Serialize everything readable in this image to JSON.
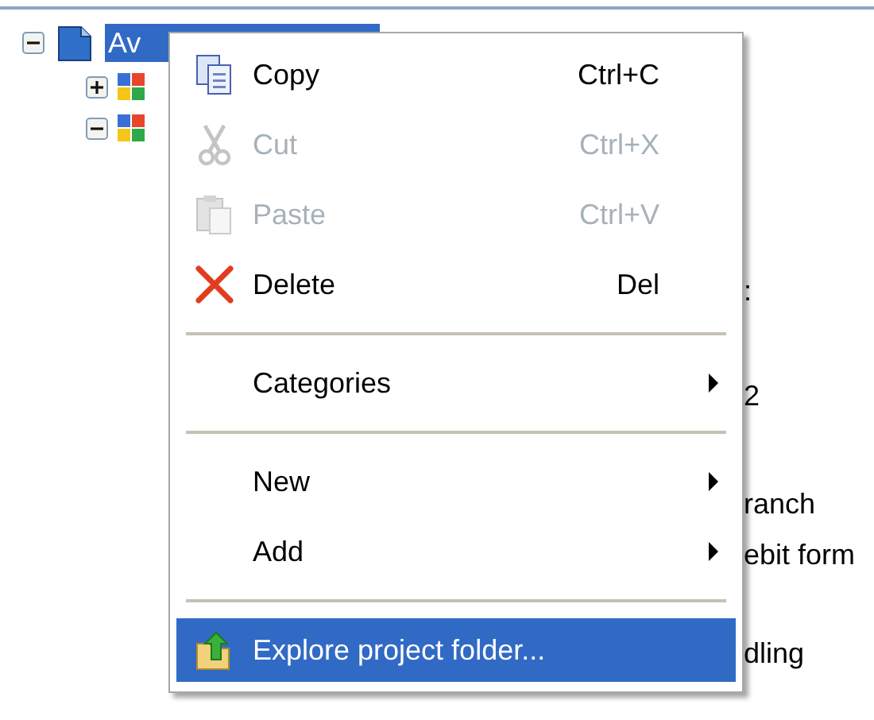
{
  "tree": {
    "root": {
      "label": "Av",
      "selected": true,
      "expanded": true
    },
    "children": [
      {
        "expanded": false
      },
      {
        "expanded": true
      }
    ]
  },
  "peek_texts": [
    ":",
    "2",
    "ranch",
    "ebit form",
    "dling"
  ],
  "context_menu": [
    {
      "kind": "item",
      "label": "Copy",
      "shortcut": "Ctrl+C",
      "disabled": false,
      "selected": false,
      "submenu": false
    },
    {
      "kind": "item",
      "label": "Cut",
      "shortcut": "Ctrl+X",
      "disabled": true,
      "selected": false,
      "submenu": false
    },
    {
      "kind": "item",
      "label": "Paste",
      "shortcut": "Ctrl+V",
      "disabled": true,
      "selected": false,
      "submenu": false
    },
    {
      "kind": "item",
      "label": "Delete",
      "shortcut": "Del",
      "disabled": false,
      "selected": false,
      "submenu": false
    },
    {
      "kind": "separator"
    },
    {
      "kind": "item",
      "label": "Categories",
      "disabled": false,
      "selected": false,
      "submenu": true
    },
    {
      "kind": "separator"
    },
    {
      "kind": "item",
      "label": "New",
      "disabled": false,
      "selected": false,
      "submenu": true
    },
    {
      "kind": "item",
      "label": "Add",
      "disabled": false,
      "selected": false,
      "submenu": true
    },
    {
      "kind": "separator"
    },
    {
      "kind": "item",
      "label": "Explore project folder...",
      "disabled": false,
      "selected": true,
      "submenu": false
    }
  ]
}
